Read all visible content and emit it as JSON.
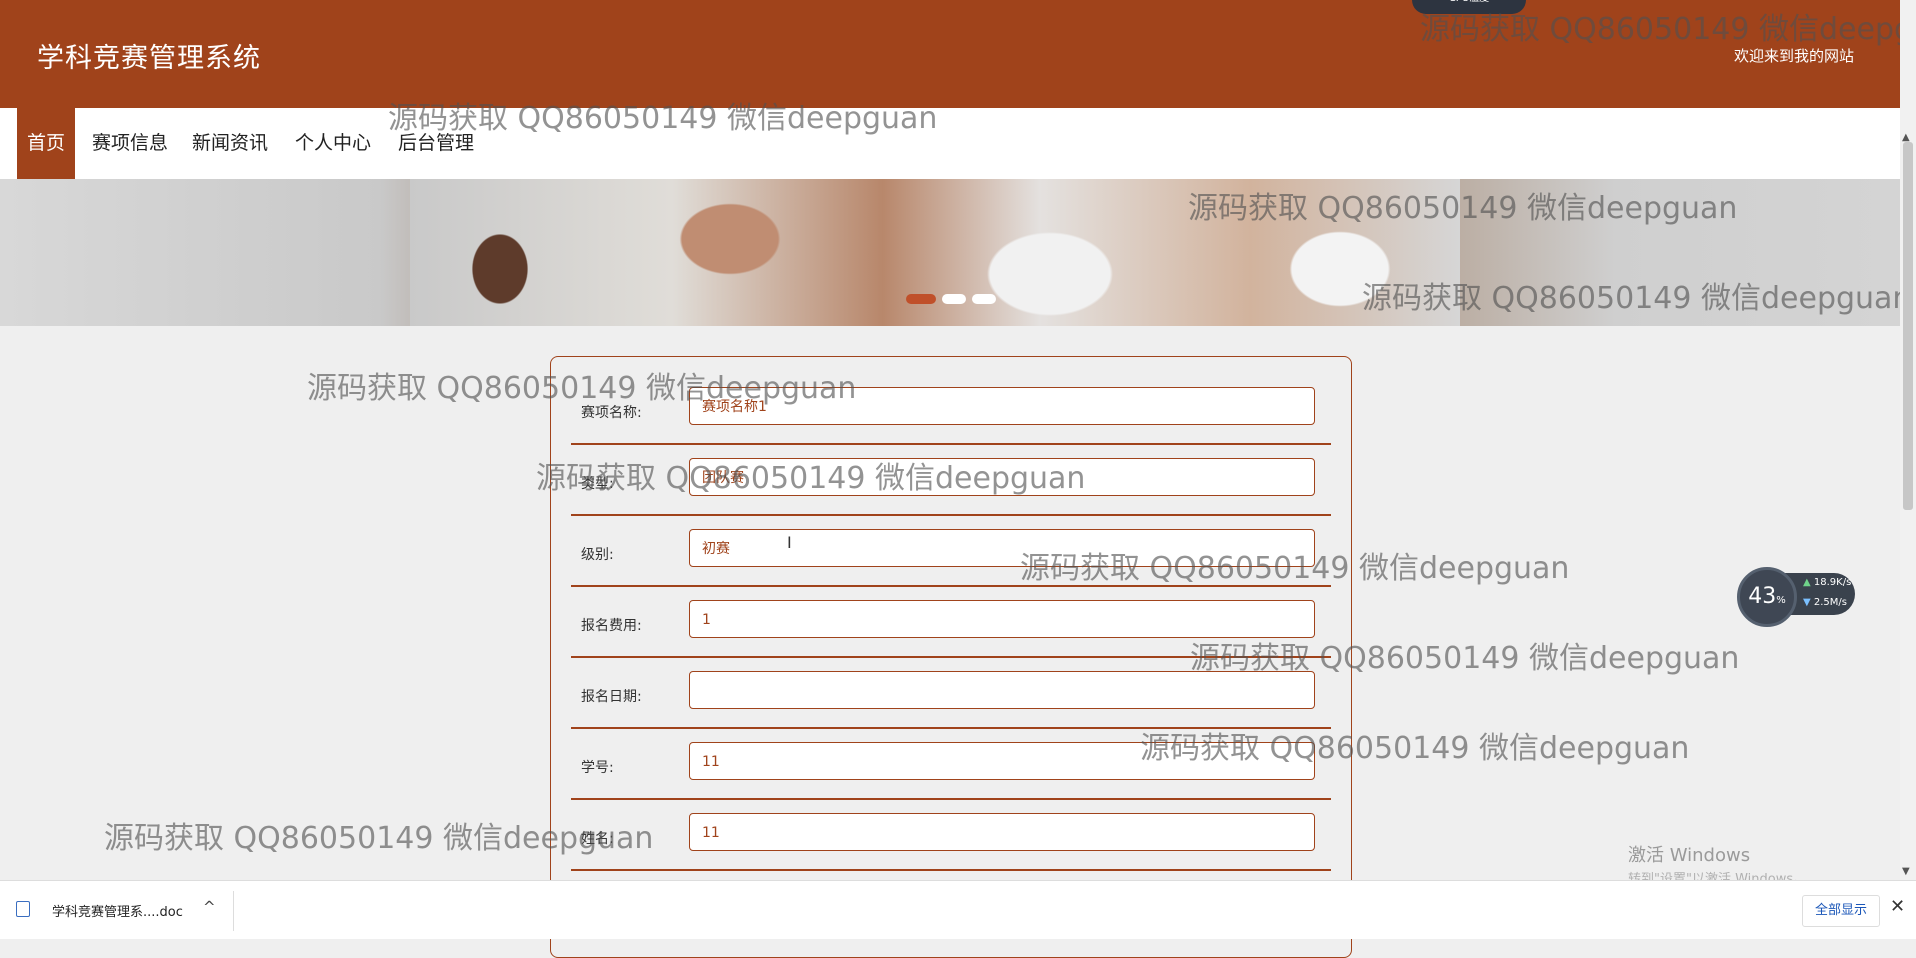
{
  "header": {
    "site_title": "学科竞赛管理系统",
    "welcome": "欢迎来到我的网站",
    "cpu_badge": "CPU温度"
  },
  "nav": {
    "items": [
      {
        "label": "首页",
        "active": true
      },
      {
        "label": "赛项信息"
      },
      {
        "label": "新闻资讯"
      },
      {
        "label": "个人中心"
      },
      {
        "label": "后台管理"
      }
    ]
  },
  "carousel": {
    "slides": 3,
    "active_index": 0
  },
  "form": {
    "fields": [
      {
        "label": "赛项名称:",
        "value": "赛项名称1"
      },
      {
        "label": "类型:",
        "value": "团队赛"
      },
      {
        "label": "级别:",
        "value": "初赛"
      },
      {
        "label": "报名费用:",
        "value": "1"
      },
      {
        "label": "报名日期:",
        "value": ""
      },
      {
        "label": "学号:",
        "value": "11"
      },
      {
        "label": "姓名:",
        "value": "11"
      }
    ]
  },
  "watermark_text": "源码获取 QQ86050149 微信deepguan",
  "net_widget": {
    "percent": "43",
    "percent_unit": "%",
    "upload": "18.9",
    "upload_unit": "K/s",
    "download": "2.5",
    "download_unit": "M/s"
  },
  "windows_activation": {
    "title": "激活 Windows",
    "subtitle": "转到\"设置\"以激活 Windows。"
  },
  "download_bar": {
    "file_name": "学科竞赛管理系....doc",
    "show_all": "全部显示"
  },
  "colors": {
    "brand": "#a0431b",
    "background": "#efefef"
  }
}
